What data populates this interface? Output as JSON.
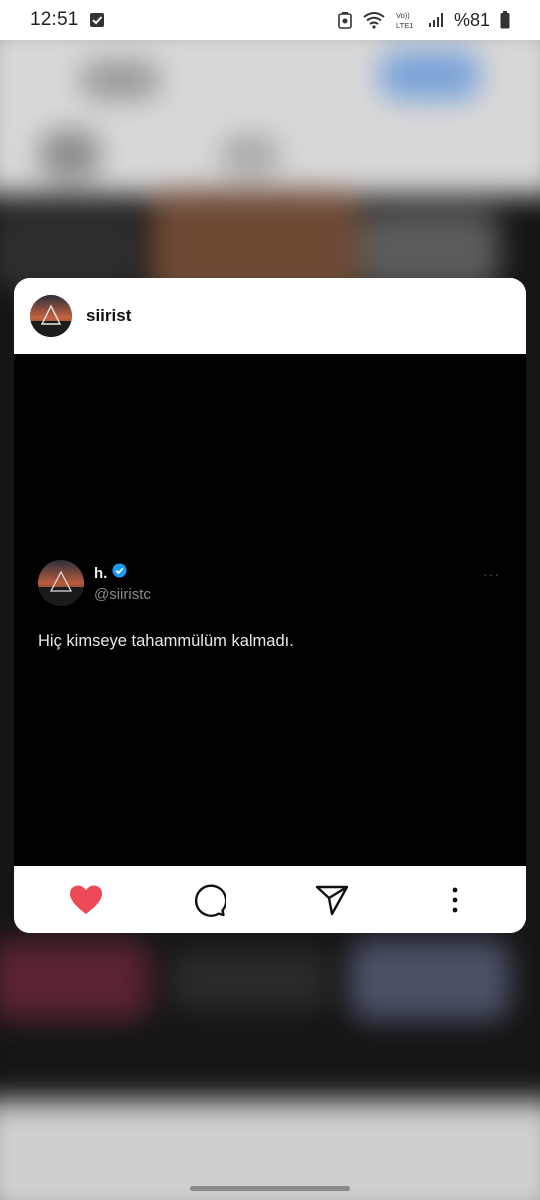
{
  "status_bar": {
    "time": "12:51",
    "battery": "%81",
    "icons": [
      "check-notification-icon",
      "android-recycle-icon",
      "wifi-icon",
      "volte-icon",
      "signal-icon",
      "battery-icon"
    ],
    "network_label_top": "Vo))",
    "network_label_bottom": "LTE1"
  },
  "post": {
    "username": "siirist",
    "tweet": {
      "display_name": "h.",
      "handle": "@siiristc",
      "text": "Hiç kimseye tahammülüm kalmadı.",
      "verified": true
    },
    "liked": true
  },
  "actions": {
    "like": "heart-icon",
    "comment": "comment-icon",
    "share": "send-icon",
    "more": "more-vertical-icon"
  },
  "colors": {
    "like_red": "#ed4956",
    "verified_blue": "#1d9bf0"
  }
}
